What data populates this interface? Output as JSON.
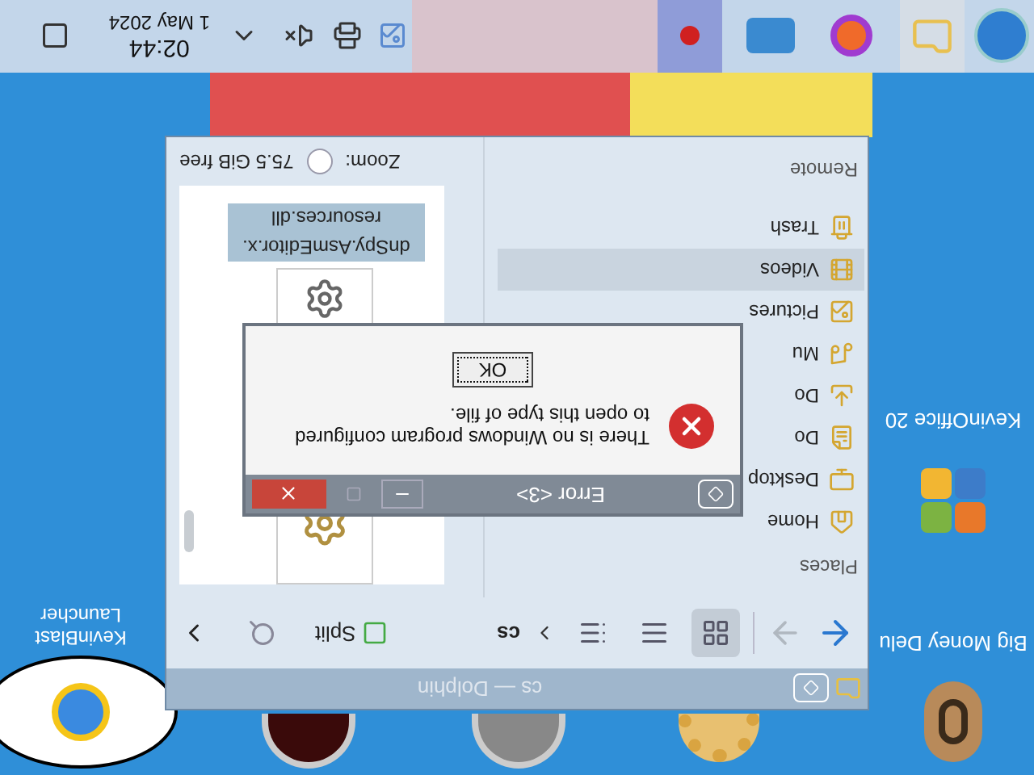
{
  "taskbar": {
    "clock": {
      "time": "02:44",
      "date": "1 May 2024"
    }
  },
  "desktop_icons": [
    {
      "kind": "money",
      "label": "Big Money Delu"
    },
    {
      "kind": "office",
      "label": "KevinOffice 20"
    },
    {
      "kind": "bubble",
      "label": "KevinBlast Launcher"
    }
  ],
  "dolphin": {
    "title": "cs — Dolphin",
    "view_modes": [
      {
        "selected": true
      },
      {
        "selected": false
      },
      {
        "selected": false
      }
    ],
    "breadcrumb": "cs",
    "split_label": "Split",
    "places": {
      "heading": "Places",
      "items": [
        {
          "label": "Home",
          "selected": false
        },
        {
          "label": "Desktop",
          "selected": false
        },
        {
          "label": "Do",
          "selected": false
        },
        {
          "label": "Do",
          "selected": false
        },
        {
          "label": "Mu",
          "selected": false
        },
        {
          "label": "Pictures",
          "selected": false
        },
        {
          "label": "Videos",
          "selected": true
        },
        {
          "label": "Trash",
          "selected": false
        }
      ],
      "footer_heading": "Remote"
    },
    "files": [
      {
        "name": "dnSpy.AsmEditor.x.\nresources.dll",
        "selected": true
      }
    ],
    "status": {
      "zoom_label": "Zoom:",
      "free_space": "75.5 GiB free"
    }
  },
  "dialog": {
    "title": "Error <3>",
    "message": "There is no Windows program configured to open this type of file.",
    "button": "OK"
  }
}
